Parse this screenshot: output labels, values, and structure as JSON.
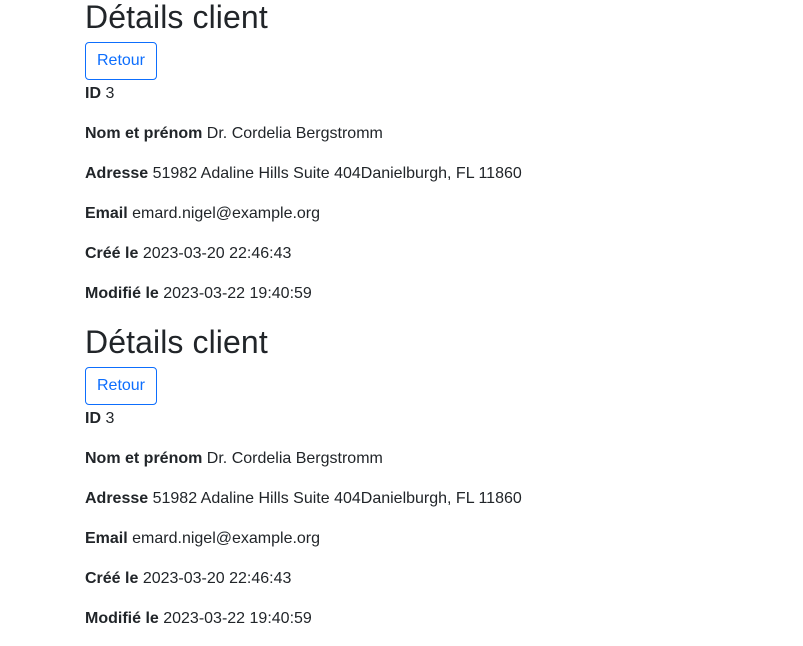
{
  "sections": [
    {
      "title": "Détails client",
      "back_label": "Retour",
      "fields": [
        {
          "label": "ID",
          "value": "3"
        },
        {
          "label": "Nom et prénom",
          "value": "Dr. Cordelia Bergstromm"
        },
        {
          "label": "Adresse",
          "value": "51982 Adaline Hills Suite 404Danielburgh, FL 11860"
        },
        {
          "label": "Email",
          "value": "emard.nigel@example.org"
        },
        {
          "label": "Créé le",
          "value": "2023-03-20 22:46:43"
        },
        {
          "label": "Modifié le",
          "value": "2023-03-22 19:40:59"
        }
      ]
    },
    {
      "title": "Détails client",
      "back_label": "Retour",
      "fields": [
        {
          "label": "ID",
          "value": "3"
        },
        {
          "label": "Nom et prénom",
          "value": "Dr. Cordelia Bergstromm"
        },
        {
          "label": "Adresse",
          "value": "51982 Adaline Hills Suite 404Danielburgh, FL 11860"
        },
        {
          "label": "Email",
          "value": "emard.nigel@example.org"
        },
        {
          "label": "Créé le",
          "value": "2023-03-20 22:46:43"
        },
        {
          "label": "Modifié le",
          "value": "2023-03-22 19:40:59"
        }
      ]
    }
  ],
  "colors": {
    "accent": "#0d6efd",
    "text": "#212529",
    "background": "#ffffff"
  }
}
